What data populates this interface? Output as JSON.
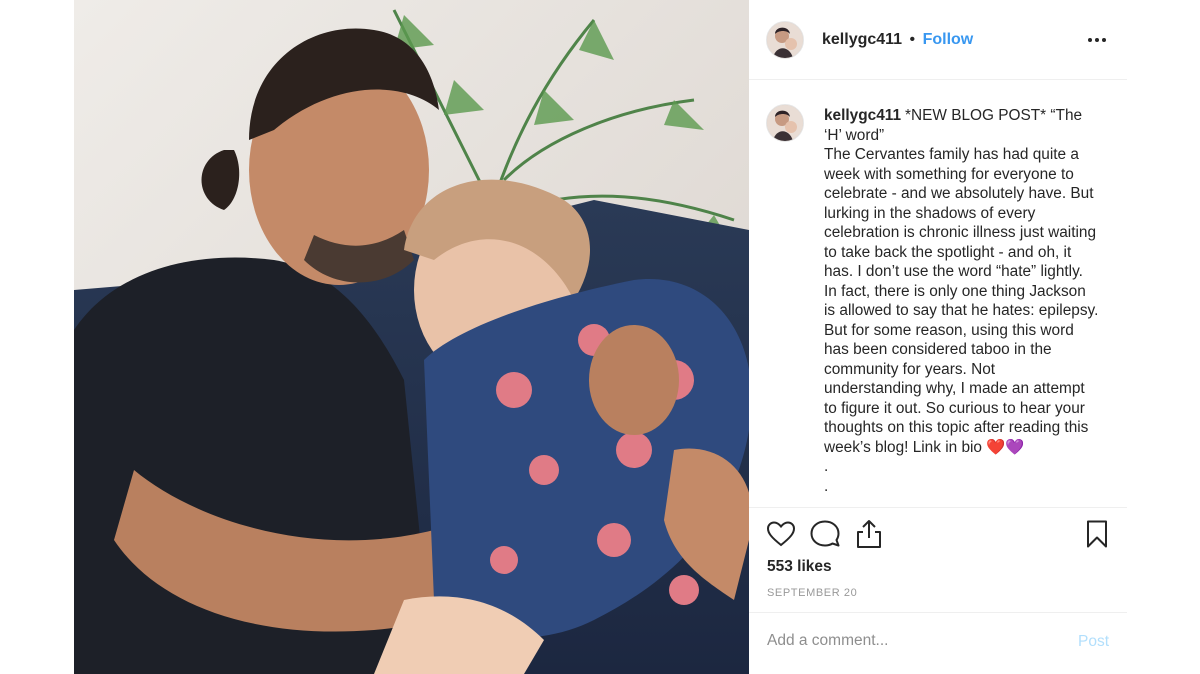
{
  "post": {
    "username": "kellygc411",
    "separator": "•",
    "follow_label": "Follow",
    "more_icon": "more-horizontal-icon",
    "caption_lines": [
      "*NEW BLOG POST* “The",
      "‘H’ word”",
      "The Cervantes family has had quite a",
      "week with something for everyone to",
      "celebrate - and we absolutely have. But",
      "lurking in the shadows of every",
      "celebration is chronic illness just waiting",
      "to take back the spotlight - and oh, it",
      "has. I don’t use the word “hate” lightly.",
      "In fact, there is only one thing Jackson",
      "is allowed to say that he hates: epilepsy.",
      "But for some reason, using this word",
      "has been considered taboo in the",
      "community for years. Not",
      "understanding why, I made an attempt",
      "to figure it out. So curious to hear your",
      "thoughts on this topic after reading this",
      "week’s blog! Link in bio ❤️💜",
      ".",
      "."
    ],
    "likes": "553 likes",
    "date": "SEPTEMBER 20",
    "comment_placeholder": "Add a comment...",
    "post_label": "Post",
    "icons": [
      "heart-icon",
      "comment-icon",
      "share-icon",
      "bookmark-icon"
    ],
    "colors": {
      "follow": "#3897f0",
      "post_disabled": "#b2dffc",
      "secondary_text": "#999999",
      "divider": "#efefef"
    }
  }
}
